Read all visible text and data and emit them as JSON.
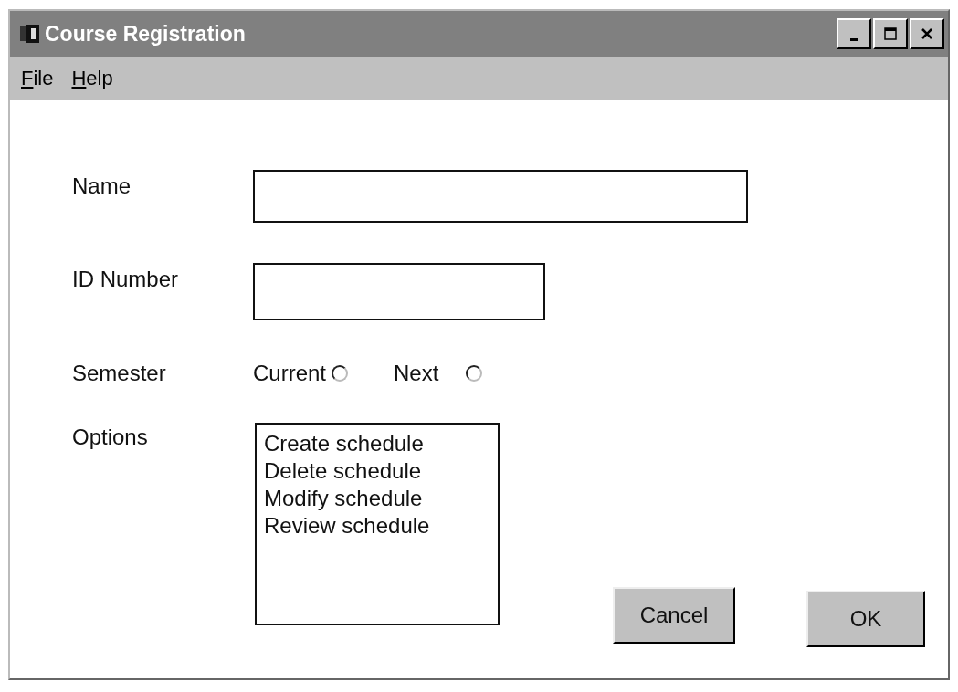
{
  "window": {
    "title": "Course Registration"
  },
  "menu": [
    "File",
    "Help"
  ],
  "form": {
    "name_label": "Name",
    "id_label": "ID Number",
    "semester_label": "Semester",
    "options_label": "Options"
  },
  "semester": [
    {
      "label": "Current",
      "selected": false
    },
    {
      "label": "Next",
      "selected": false
    }
  ],
  "options": [
    "Create schedule",
    "Delete schedule",
    "Modify schedule",
    "Review schedule"
  ],
  "buttons": [
    "Cancel",
    "OK"
  ]
}
